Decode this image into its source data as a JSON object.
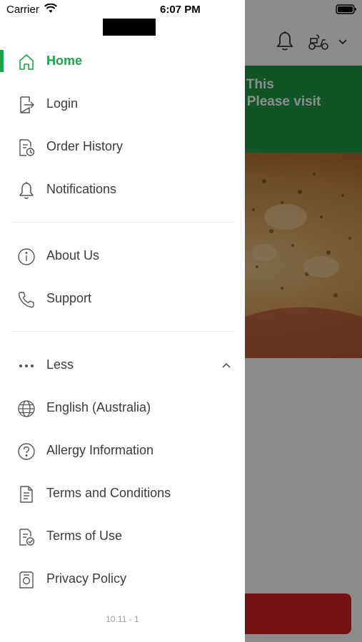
{
  "status_bar": {
    "carrier": "Carrier",
    "time": "6:07 PM"
  },
  "background": {
    "banner_text": "ed, This\non. Please visit\n/",
    "banner_color": "#1f9b47",
    "bottom_button_color": "#d32222"
  },
  "colors": {
    "accent": "#19a34a",
    "text": "#3b3b3b",
    "muted": "#9a9a9a"
  },
  "menu": {
    "primary": [
      {
        "label": "Home",
        "icon": "home-icon",
        "active": true
      },
      {
        "label": "Login",
        "icon": "login-icon"
      },
      {
        "label": "Order History",
        "icon": "order-history-icon"
      },
      {
        "label": "Notifications",
        "icon": "bell-icon"
      }
    ],
    "secondary": [
      {
        "label": "About Us",
        "icon": "info-icon"
      },
      {
        "label": "Support",
        "icon": "phone-icon"
      }
    ],
    "more_toggle": {
      "label": "Less",
      "icon": "more-dots-icon",
      "expanded": true
    },
    "more_items": [
      {
        "label": "English (Australia)",
        "icon": "globe-icon"
      },
      {
        "label": "Allergy Information",
        "icon": "question-icon"
      },
      {
        "label": "Terms and Conditions",
        "icon": "document-icon"
      },
      {
        "label": "Terms of Use",
        "icon": "document-check-icon"
      },
      {
        "label": "Privacy Policy",
        "icon": "privacy-icon"
      }
    ]
  },
  "version": "10.11 - 1"
}
